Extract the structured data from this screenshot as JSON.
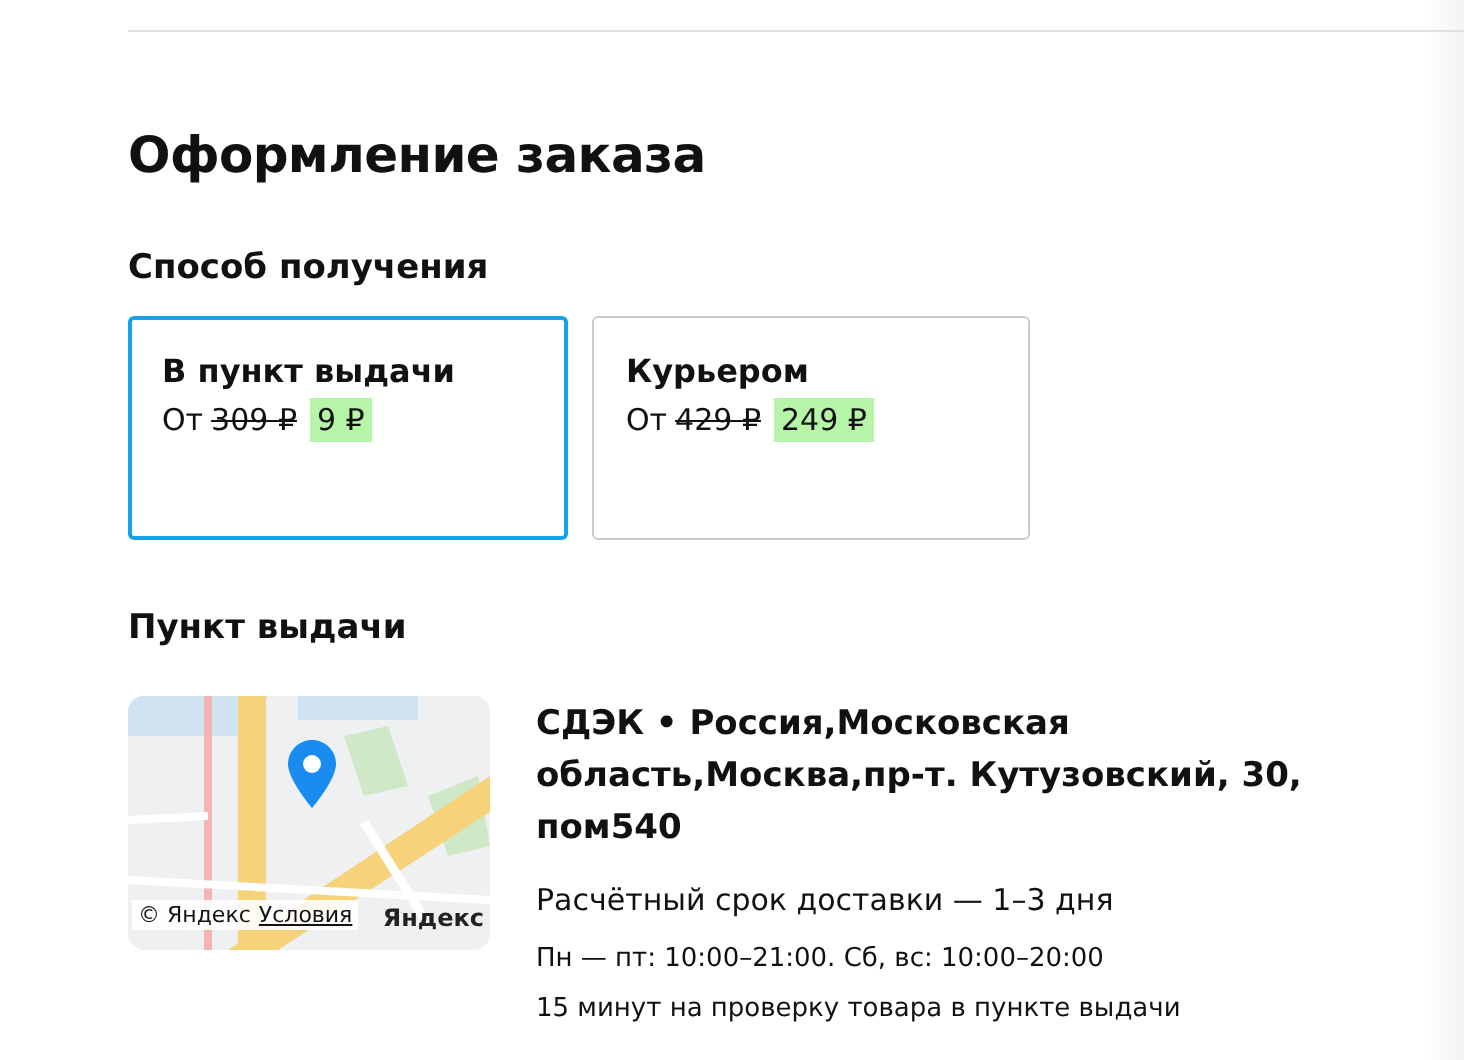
{
  "page": {
    "title": "Оформление заказа"
  },
  "delivery_method": {
    "heading": "Способ получения",
    "options": [
      {
        "label": "В пункт выдачи",
        "prefix": "От",
        "old_price": "309 ₽",
        "price": "9 ₽",
        "selected": true
      },
      {
        "label": "Курьером",
        "prefix": "От",
        "old_price": "429 ₽",
        "price": "249 ₽",
        "selected": false
      }
    ]
  },
  "pickup_point": {
    "heading": "Пункт выдачи",
    "map": {
      "attribution": "© Яндекс",
      "terms_link": "Условия",
      "logo": "Яндекс"
    },
    "address": "СДЭК • Россия,Московская область,Москва,пр-т. Кутузовский, 30, пом540",
    "delivery_time": "Расчётный срок доставки — 1–3 дня",
    "hours": "Пн — пт: 10:00–21:00. Сб, вс: 10:00–20:00",
    "note": "15 минут на проверку товара в пункте выдачи"
  }
}
